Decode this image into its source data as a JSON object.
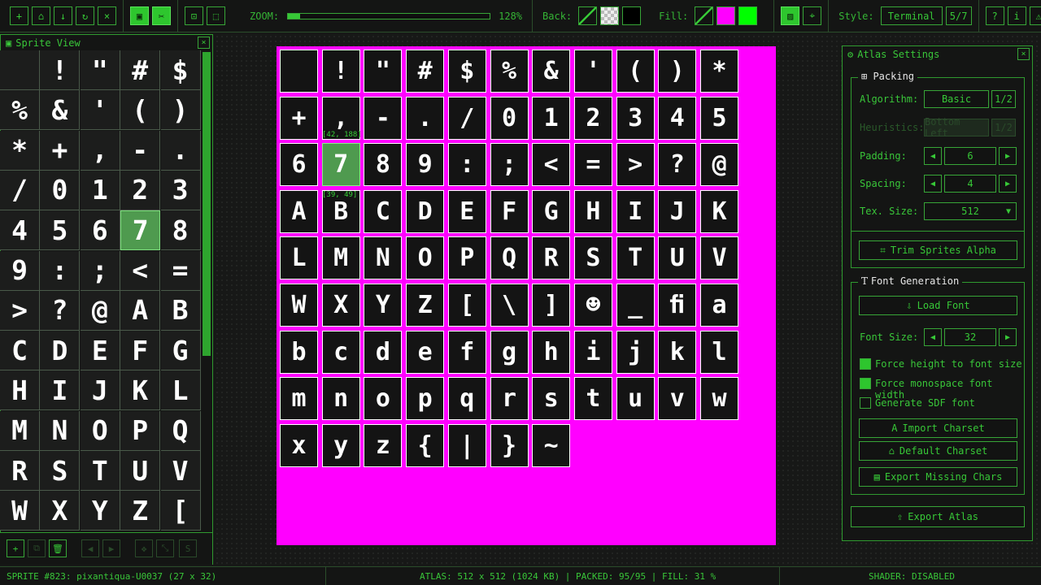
{
  "toolbar": {
    "zoom_label": "ZOOM:",
    "zoom_value": "128%",
    "zoom_fraction": 0.06,
    "back_label": "Back:",
    "fill_label": "Fill:",
    "style_label": "Style:",
    "style_value": "Terminal",
    "style_page": "5/7"
  },
  "sprite_view": {
    "title": "Sprite View",
    "chars": [
      "",
      "!",
      "\"",
      "#",
      "$",
      "%",
      "&",
      "'",
      "(",
      ")",
      "*",
      "+",
      ",",
      "-",
      ".",
      "/",
      "0",
      "1",
      "2",
      "3",
      "4",
      "5",
      "6",
      "7",
      "8",
      "9",
      ":",
      ";",
      "<",
      "=",
      ">",
      "?",
      "@",
      "A",
      "B",
      "C",
      "D",
      "E",
      "F",
      "G",
      "H",
      "I",
      "J",
      "K",
      "L",
      "M",
      "N",
      "O",
      "P",
      "Q",
      "R",
      "S",
      "T",
      "U",
      "V",
      "W",
      "X",
      "Y",
      "Z",
      "["
    ],
    "selected_index": 23
  },
  "atlas": {
    "glyphs": [
      "",
      "!",
      "\"",
      "#",
      "$",
      "%",
      "&",
      "'",
      "(",
      ")",
      "*",
      "+",
      ",",
      "-",
      ".",
      "/",
      "0",
      "1",
      "2",
      "3",
      "4",
      "5",
      "6",
      "7",
      "8",
      "9",
      ":",
      ";",
      "<",
      "=",
      ">",
      "?",
      "@",
      "A",
      "B",
      "C",
      "D",
      "E",
      "F",
      "G",
      "H",
      "I",
      "J",
      "K",
      "L",
      "M",
      "N",
      "O",
      "P",
      "Q",
      "R",
      "S",
      "T",
      "U",
      "V",
      "W",
      "X",
      "Y",
      "Z",
      "[",
      "\\",
      "]",
      "☻",
      "_",
      "ﬁ",
      "a",
      "b",
      "c",
      "d",
      "e",
      "f",
      "g",
      "h",
      "i",
      "j",
      "k",
      "l",
      "m",
      "n",
      "o",
      "p",
      "q",
      "r",
      "s",
      "t",
      "u",
      "v",
      "w",
      "x",
      "y",
      "z",
      "{",
      "|",
      "}",
      "~"
    ],
    "selected_index": 23,
    "sel_pos_label": "[42, 188]",
    "sel_size_label": "[39, 49]"
  },
  "settings": {
    "title": "Atlas Settings",
    "packing": {
      "title": "Packing",
      "algorithm_label": "Algorithm:",
      "algorithm_value": "Basic",
      "algorithm_page": "1/2",
      "heuristics_label": "Heuristics:",
      "heuristics_value": "Bottom Left",
      "heuristics_page": "1/2",
      "padding_label": "Padding:",
      "padding_value": "6",
      "spacing_label": "Spacing:",
      "spacing_value": "4",
      "texsize_label": "Tex. Size:",
      "texsize_value": "512",
      "trim_label": "Trim Sprites Alpha"
    },
    "font": {
      "title": "Font Generation",
      "load_label": "Load Font",
      "fontsize_label": "Font Size:",
      "fontsize_value": "32",
      "force_height_label": "Force height to font size",
      "force_mono_label": "Force monospace font width",
      "sdf_label": "Generate SDF font",
      "import_label": "Import Charset",
      "default_label": "Default Charset",
      "export_missing_label": "Export Missing Chars"
    },
    "export_label": "Export Atlas"
  },
  "status": {
    "sprite": "SPRITE #823: pixantiqua-U0037 (27 x 32)",
    "atlas": "ATLAS: 512 x 512 (1024 KB)  |  PACKED: 95/95  |  FILL: 31 %",
    "shader": "SHADER: DISABLED"
  },
  "colors": {
    "accent": "#37c837",
    "atlas_bg": "#ff00ff",
    "fill_color": "#ff00ff",
    "fill_color_2": "#00ff00"
  }
}
